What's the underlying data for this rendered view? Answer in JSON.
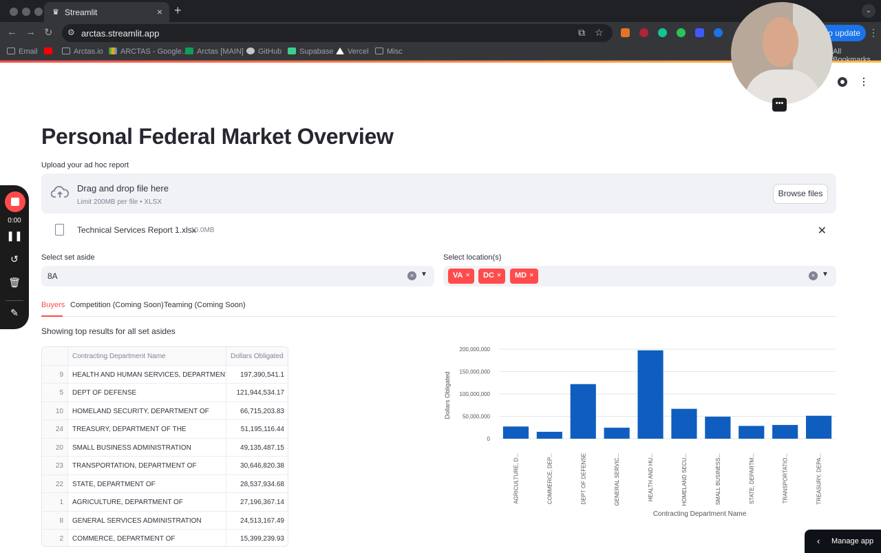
{
  "browser": {
    "tab_title": "Streamlit",
    "url": "arctas.streamlit.app",
    "update_label": "to update",
    "bookmarks": [
      {
        "label": "Email",
        "kind": "folder"
      },
      {
        "label": "",
        "kind": "youtube"
      },
      {
        "label": "Arctas.io",
        "kind": "folder"
      },
      {
        "label": "ARCTAS - Google...",
        "kind": "drive"
      },
      {
        "label": "Arctas [MAIN]",
        "kind": "sheets"
      },
      {
        "label": "GitHub",
        "kind": "github"
      },
      {
        "label": "Supabase",
        "kind": "supabase"
      },
      {
        "label": "Vercel",
        "kind": "vercel"
      },
      {
        "label": "Misc",
        "kind": "folder"
      }
    ],
    "all_bookmarks_label": "All Bookmarks"
  },
  "page": {
    "title": "Personal Federal Market Overview",
    "upload_label": "Upload your ad hoc report",
    "dropzone_main": "Drag and drop file here",
    "dropzone_sub": "Limit 200MB per file • XLSX",
    "browse_label": "Browse files",
    "file_name": "Technical Services Report 1.xlsx",
    "file_size": "10.0MB",
    "set_aside_label": "Select set aside",
    "set_aside_value": "8A",
    "location_label": "Select location(s)",
    "locations": [
      "VA",
      "DC",
      "MD"
    ],
    "tabs": [
      "Buyers",
      "Competition (Coming Soon)",
      "Teaming (Coming Soon)"
    ],
    "showing_text": "Showing top results for all set asides",
    "manage_label": "Manage app"
  },
  "table": {
    "headers": [
      "",
      "Contracting Department Name",
      "Dollars Obligated"
    ],
    "rows": [
      {
        "idx": "9",
        "name": "HEALTH AND HUMAN SERVICES, DEPARTMENT OF",
        "dollars": "197,390,541.1"
      },
      {
        "idx": "5",
        "name": "DEPT OF DEFENSE",
        "dollars": "121,944,534.17"
      },
      {
        "idx": "10",
        "name": "HOMELAND SECURITY, DEPARTMENT OF",
        "dollars": "66,715,203.83"
      },
      {
        "idx": "24",
        "name": "TREASURY, DEPARTMENT OF THE",
        "dollars": "51,195,116.44"
      },
      {
        "idx": "20",
        "name": "SMALL BUSINESS ADMINISTRATION",
        "dollars": "49,135,487.15"
      },
      {
        "idx": "23",
        "name": "TRANSPORTATION, DEPARTMENT OF",
        "dollars": "30,646,820.38"
      },
      {
        "idx": "22",
        "name": "STATE, DEPARTMENT OF",
        "dollars": "28,537,934.68"
      },
      {
        "idx": "1",
        "name": "AGRICULTURE, DEPARTMENT OF",
        "dollars": "27,196,367.14"
      },
      {
        "idx": "8",
        "name": "GENERAL SERVICES ADMINISTRATION",
        "dollars": "24,513,167.49"
      },
      {
        "idx": "2",
        "name": "COMMERCE, DEPARTMENT OF",
        "dollars": "15,399,239.93"
      }
    ]
  },
  "recorder": {
    "time": "0:00"
  },
  "colors": {
    "accent": "#ff4b4b",
    "bar": "#0f5ebf"
  },
  "chart_data": {
    "type": "bar",
    "categories": [
      "AGRICULTURE, D...",
      "COMMERCE, DEP...",
      "DEPT OF DEFENSE",
      "GENERAL SERVIC...",
      "HEALTH AND HU...",
      "HOMELAND SECU...",
      "SMALL BUSINESS...",
      "STATE, DEPARTM...",
      "TRANSPORTATIO...",
      "TREASURY, DEPA..."
    ],
    "values": [
      27196367.14,
      15399239.93,
      121944534.17,
      24513167.49,
      197390541.1,
      66715203.83,
      49135487.15,
      28537934.68,
      30646820.38,
      51195116.44
    ],
    "xlabel": "Contracting Department Name",
    "ylabel": "Dollars Obligated",
    "ylim": [
      0,
      200000000
    ],
    "yticks": [
      0,
      50000000,
      100000000,
      150000000,
      200000000
    ],
    "ytick_labels": [
      "0",
      "50,000,000",
      "100,000,000",
      "150,000,000",
      "200,000,000"
    ],
    "grid": true
  }
}
